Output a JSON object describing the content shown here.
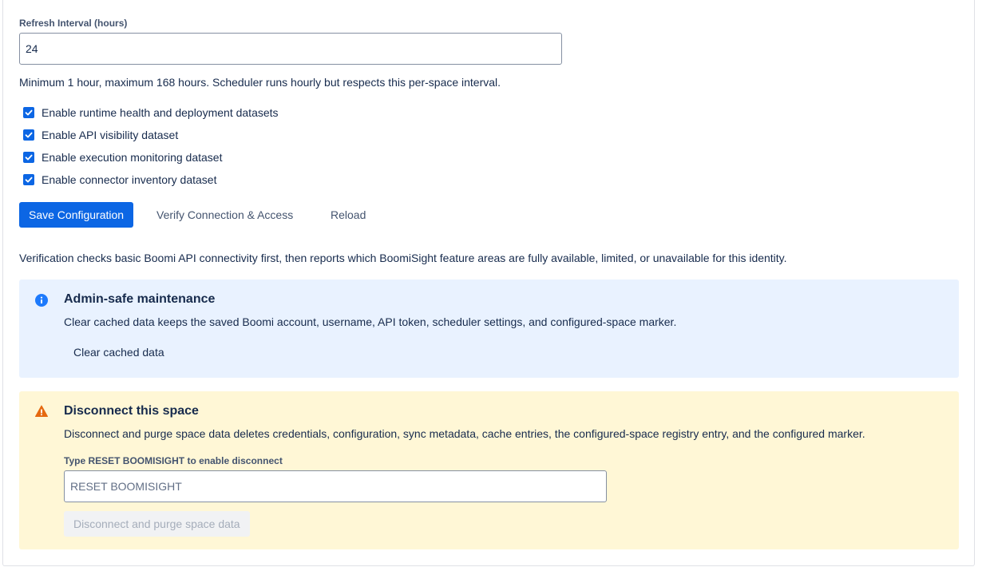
{
  "refresh": {
    "label": "Refresh Interval (hours)",
    "value": "24",
    "helper": "Minimum 1 hour, maximum 168 hours. Scheduler runs hourly but respects this per-space interval."
  },
  "options": [
    {
      "label": "Enable runtime health and deployment datasets",
      "checked": true
    },
    {
      "label": "Enable API visibility dataset",
      "checked": true
    },
    {
      "label": "Enable execution monitoring dataset",
      "checked": true
    },
    {
      "label": "Enable connector inventory dataset",
      "checked": true
    }
  ],
  "actions": {
    "save": "Save Configuration",
    "verify": "Verify Connection & Access",
    "reload": "Reload"
  },
  "verify_note": "Verification checks basic Boomi API connectivity first, then reports which BoomiSight feature areas are fully available, limited, or unavailable for this identity.",
  "maintenance": {
    "title": "Admin-safe maintenance",
    "text": "Clear cached data keeps the saved Boomi account, username, API token, scheduler settings, and configured-space marker.",
    "button": "Clear cached data",
    "icon": "info-icon",
    "color": "#e9f2ff"
  },
  "disconnect": {
    "title": "Disconnect this space",
    "text": "Disconnect and purge space data deletes credentials, configuration, sync metadata, cache entries, the configured-space registry entry, and the configured marker.",
    "confirm_label": "Type RESET BOOMISIGHT to enable disconnect",
    "confirm_placeholder": "RESET BOOMISIGHT",
    "button": "Disconnect and purge space data",
    "icon": "warning-icon",
    "color": "#fff7d6"
  },
  "colors": {
    "primary": "#0c66e4",
    "info_icon": "#1d7afc",
    "warning_icon": "#e56910"
  }
}
